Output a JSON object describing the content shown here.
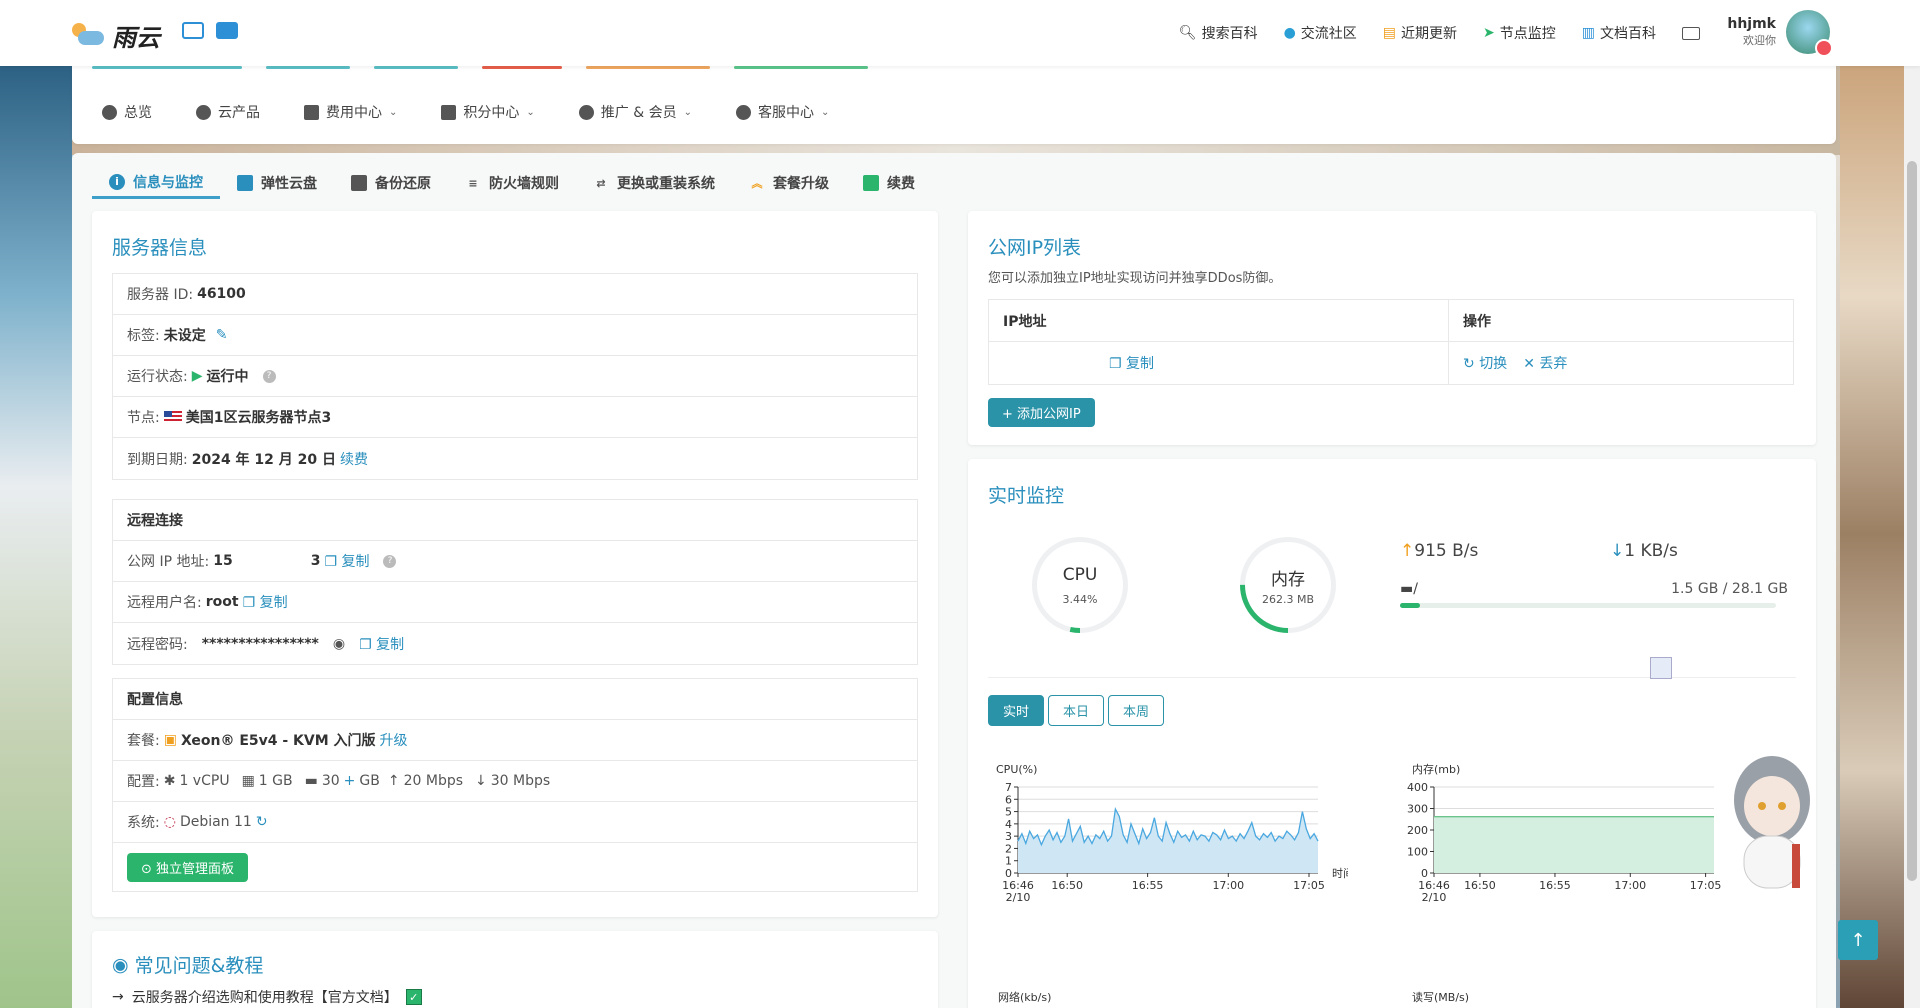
{
  "brand": {
    "name": "雨云"
  },
  "nav": {
    "links": [
      {
        "label": "搜索百科",
        "icon": "search-icon"
      },
      {
        "label": "交流社区",
        "icon": "community-icon"
      },
      {
        "label": "近期更新",
        "icon": "update-icon"
      },
      {
        "label": "节点监控",
        "icon": "location-arrow-icon"
      },
      {
        "label": "文档百科",
        "icon": "book-icon"
      }
    ],
    "user": {
      "name": "hhjmk",
      "greeting": "欢迎你"
    }
  },
  "main_menu": [
    {
      "label": "总览",
      "dropdown": false
    },
    {
      "label": "云产品",
      "dropdown": false
    },
    {
      "label": "费用中心",
      "dropdown": true
    },
    {
      "label": "积分中心",
      "dropdown": true
    },
    {
      "label": "推广 & 会员",
      "dropdown": true
    },
    {
      "label": "客服中心",
      "dropdown": true
    }
  ],
  "tabs": [
    {
      "label": "信息与监控",
      "active": true
    },
    {
      "label": "弹性云盘"
    },
    {
      "label": "备份还原"
    },
    {
      "label": "防火墙规则"
    },
    {
      "label": "更换或重装系统"
    },
    {
      "label": "套餐升级"
    },
    {
      "label": "续费"
    }
  ],
  "server_info": {
    "title": "服务器信息",
    "id_label": "服务器 ID:",
    "id": "46100",
    "tag_label": "标签:",
    "tag": "未设定",
    "status_label": "运行状态:",
    "status": "运行中",
    "node_label": "节点:",
    "node": "美国1区云服务器节点3",
    "expire_label": "到期日期:",
    "expire": "2024 年 12 月 20 日",
    "renew": "续费"
  },
  "remote": {
    "heading": "远程连接",
    "ip_label": "公网 IP 地址:",
    "ip_start": "15",
    "ip_end": "3",
    "user_label": "远程用户名:",
    "user": "root",
    "pwd_label": "远程密码:",
    "pwd": "****************",
    "copy": "复制"
  },
  "config": {
    "heading": "配置信息",
    "plan_label": "套餐:",
    "plan": "Xeon® E5v4 - KVM 入门版",
    "upgrade": "升级",
    "spec_label": "配置:",
    "cpu": "1 vCPU",
    "ram": "1 GB",
    "disk_main": "30",
    "disk_plus": "+",
    "disk_unit": "GB",
    "up": "20 Mbps",
    "down": "30 Mbps",
    "os_label": "系统:",
    "os": "Debian 11",
    "panel_button": "独立管理面板"
  },
  "faq": {
    "title": "常见问题&教程",
    "item": "云服务器介绍选购和使用教程【官方文档】"
  },
  "ip_list": {
    "title": "公网IP列表",
    "desc": "您可以添加独立IP地址实现访问并独享DDos防御。",
    "col_ip": "IP地址",
    "col_op": "操作",
    "copy": "复制",
    "switch": "切换",
    "discard": "丢弃",
    "add_button": "+ 添加公网IP"
  },
  "monitor": {
    "title": "实时监控",
    "cpu_label": "CPU",
    "cpu_value": "3.44%",
    "cpu_pct": 3.44,
    "mem_label": "内存",
    "mem_value": "262.3 MB",
    "mem_pct": 25,
    "net_up": "915 B/s",
    "net_down": "1 KB/s",
    "disk_mount": "/",
    "disk_usage": "1.5 GB / 28.1 GB",
    "disk_pct": 5.3,
    "range_buttons": [
      "实时",
      "本日",
      "本周"
    ],
    "net_label": "网络(kb/s)",
    "io_label": "读写(MB/s)"
  },
  "chart_data": [
    {
      "type": "area",
      "ylabel": "CPU(%)",
      "xlabel": "时间",
      "ylim": [
        0,
        7
      ],
      "yticks": [
        "0",
        "1",
        "2",
        "3",
        "4",
        "5",
        "6",
        "7"
      ],
      "xticks": [
        "16:46\n2/10",
        "16:50",
        "16:55",
        "17:00",
        "17:05"
      ],
      "series": [
        {
          "values": [
            2.6,
            3.2,
            2.4,
            3.4,
            2.8,
            3.1,
            2.3,
            3.0,
            3.5,
            2.7,
            3.3,
            2.5,
            3.0,
            4.4,
            2.6,
            3.2,
            3.8,
            2.5,
            3.0,
            2.4,
            3.1,
            2.8,
            3.4,
            2.6,
            3.0,
            5.2,
            4.6,
            3.1,
            2.5,
            4.0,
            3.2,
            2.4,
            3.6,
            2.8,
            3.3,
            4.5,
            3.0,
            2.6,
            4.1,
            3.2,
            2.5,
            3.4,
            2.9,
            3.1,
            2.6,
            3.4,
            2.7,
            3.1,
            3.0,
            2.6,
            3.3,
            3.1,
            2.7,
            3.5,
            2.8,
            3.0,
            2.6,
            3.2,
            2.8,
            3.4,
            4.1,
            3.0,
            2.7,
            3.2,
            2.9,
            3.3,
            2.6,
            3.0,
            2.8,
            3.4,
            3.1,
            2.7,
            3.3,
            5.0,
            3.6,
            2.8,
            3.2,
            2.6
          ]
        }
      ]
    },
    {
      "type": "area",
      "ylabel": "内存(mb)",
      "ylim": [
        0,
        400
      ],
      "yticks": [
        "0",
        "100",
        "200",
        "300",
        "400"
      ],
      "xticks": [
        "16:46\n2/10",
        "16:50",
        "16:55",
        "17:00",
        "17:05"
      ],
      "series": [
        {
          "values": [
            262,
            262,
            262,
            262,
            262,
            262,
            262,
            262,
            262,
            262,
            262,
            262,
            262,
            262,
            262,
            262,
            262,
            262,
            262,
            262
          ]
        }
      ]
    }
  ]
}
